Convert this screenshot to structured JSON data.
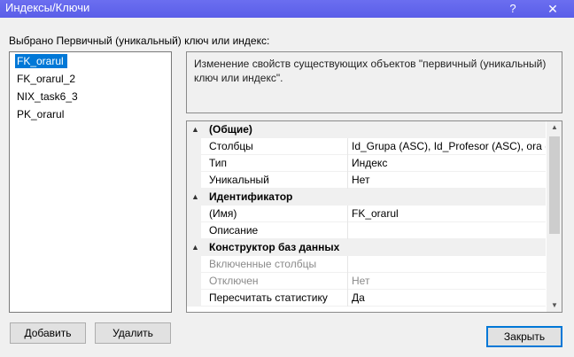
{
  "window": {
    "title": "Индексы/Ключи",
    "help_glyph": "?",
    "close_glyph": "✕"
  },
  "selected_label": "Выбрано Первичный (уникальный) ключ или индекс:",
  "keys": [
    {
      "label": "FK_orarul",
      "selected": true
    },
    {
      "label": "FK_orarul_2",
      "selected": false
    },
    {
      "label": "NIX_task6_3",
      "selected": false
    },
    {
      "label": "PK_orarul",
      "selected": false
    }
  ],
  "description": "Изменение свойств существующих объектов \"первичный (уникальный) ключ или индекс\".",
  "properties": {
    "cat_general": "(Общие)",
    "columns_name": "Столбцы",
    "columns_value": "Id_Grupa (ASC), Id_Profesor (ASC), ora (ASC)",
    "type_name": "Тип",
    "type_value": "Индекс",
    "unique_name": "Уникальный",
    "unique_value": "Нет",
    "cat_identity": "Идентификатор",
    "name_name": "(Имя)",
    "name_value": "FK_orarul",
    "desc_name": "Описание",
    "desc_value": "",
    "cat_designer": "Конструктор баз данных",
    "included_name": "Включенные столбцы",
    "included_value": "",
    "disabled_name": "Отключен",
    "disabled_value": "Нет",
    "recompute_name": "Пересчитать статистику",
    "recompute_value": "Да"
  },
  "buttons": {
    "add": "Добавить",
    "delete": "Удалить",
    "close": "Закрыть"
  },
  "icons": {
    "collapse": "▲",
    "scroll_up": "▲",
    "scroll_down": "▼"
  }
}
